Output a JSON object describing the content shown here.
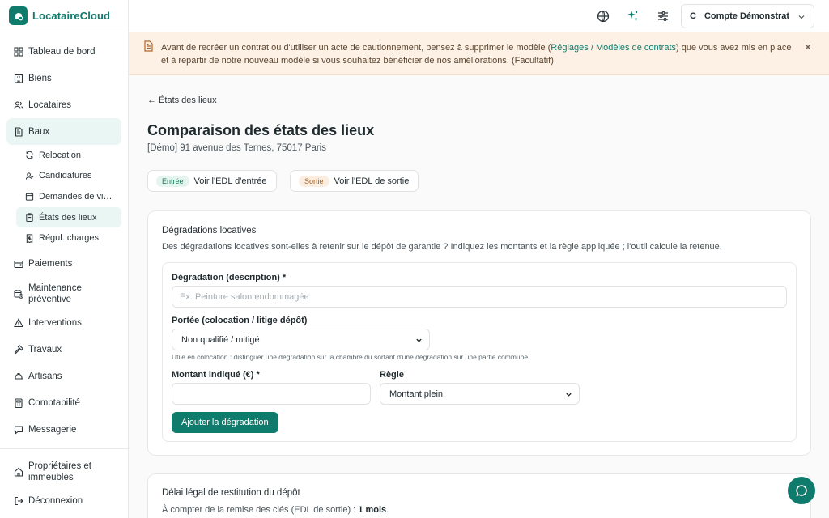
{
  "brand": {
    "name": "LocataireCloud"
  },
  "sidebar": {
    "items": [
      {
        "label": "Tableau de bord",
        "icon": "dashboard-icon"
      },
      {
        "label": "Biens",
        "icon": "building-icon"
      },
      {
        "label": "Locataires",
        "icon": "users-icon"
      },
      {
        "label": "Baux",
        "icon": "document-icon",
        "active": true
      }
    ],
    "subitems": [
      {
        "label": "Relocation",
        "icon": "refresh-icon"
      },
      {
        "label": "Candidatures",
        "icon": "user-plus-icon"
      },
      {
        "label": "Demandes de vi…",
        "icon": "calendar-icon"
      },
      {
        "label": "États des lieux",
        "icon": "clipboard-icon",
        "active": true
      },
      {
        "label": "Régul. charges",
        "icon": "receipt-icon"
      }
    ],
    "items2": [
      {
        "label": "Paiements",
        "icon": "wallet-icon"
      },
      {
        "label": "Maintenance préventive",
        "icon": "calendar-check-icon"
      },
      {
        "label": "Interventions",
        "icon": "alert-icon"
      },
      {
        "label": "Travaux",
        "icon": "hammer-icon"
      },
      {
        "label": "Artisans",
        "icon": "helmet-icon"
      },
      {
        "label": "Comptabilité",
        "icon": "calculator-icon"
      },
      {
        "label": "Messagerie",
        "icon": "chat-icon"
      }
    ],
    "bottom": [
      {
        "label": "Propriétaires et immeubles",
        "icon": "home-icon"
      },
      {
        "label": "Déconnexion",
        "icon": "logout-icon"
      }
    ]
  },
  "topbar": {
    "account_initial": "C",
    "account_name": "Compte Démonstration"
  },
  "banner": {
    "text_before": "Avant de recréer un contrat ou d'utiliser un acte de cautionnement, pensez à supprimer le modèle (",
    "link": "Réglages / Modèles de contrats",
    "text_after": ") que vous avez mis en place et à repartir de notre nouveau modèle si vous souhaitez bénéficier de nos améliorations.",
    "optional": "(Facultatif)"
  },
  "page": {
    "back": "← États des lieux",
    "title": "Comparaison des états des lieux",
    "subtitle": "[Démo] 91 avenue des Ternes, 75017 Paris",
    "entry_badge": "Entrée",
    "entry_button": "Voir l'EDL d'entrée",
    "exit_badge": "Sortie",
    "exit_button": "Voir l'EDL de sortie"
  },
  "degradations": {
    "title": "Dégradations locatives",
    "description": "Des dégradations locatives sont-elles à retenir sur le dépôt de garantie ? Indiquez les montants et la règle appliquée ; l'outil calcule la retenue.",
    "desc_label": "Dégradation (description) *",
    "desc_placeholder": "Ex. Peinture salon endommagée",
    "scope_label": "Portée (colocation / litige dépôt)",
    "scope_value": "Non qualifié / mitigé",
    "scope_hint": "Utile en colocation : distinguer une dégradation sur la chambre du sortant d'une dégradation sur une partie commune.",
    "amount_label": "Montant indiqué (€) *",
    "amount_value": "",
    "rule_label": "Règle",
    "rule_value": "Montant plein",
    "add_button": "Ajouter la dégradation"
  },
  "delay": {
    "title": "Délai légal de restitution du dépôt",
    "text": "À compter de la remise des clés (EDL de sortie) :",
    "value": "1 mois",
    "end": "."
  },
  "colors": {
    "accent": "#0f7b6c",
    "banner_bg": "#fdf1e6"
  }
}
